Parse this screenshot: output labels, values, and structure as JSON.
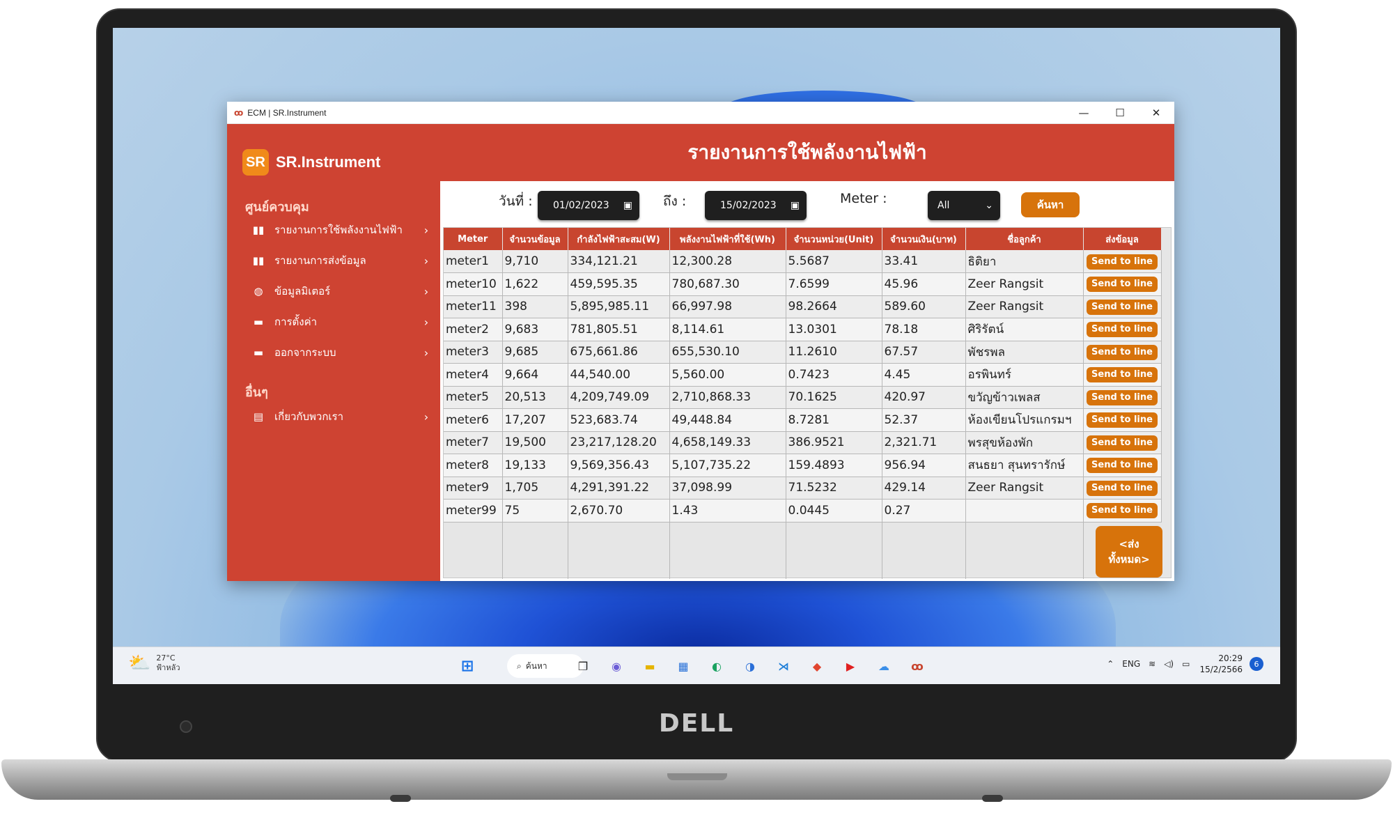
{
  "window": {
    "title": "ECM | SR.Instrument",
    "minimize": "—",
    "maximize": "☐",
    "close": "✕"
  },
  "brand": {
    "logo": "SR",
    "name": "SR.Instrument"
  },
  "sidebar": {
    "section_main": "ศูนย์ควบคุม",
    "section_other": "อื่นๆ",
    "items": [
      {
        "label": "รายงานการใช้พลังงานไฟฟ้า",
        "icon": "bar-chart-icon"
      },
      {
        "label": "รายงานการส่งข้อมูล",
        "icon": "bar-chart-icon"
      },
      {
        "label": "ข้อมูลมิเตอร์",
        "icon": "globe-icon"
      },
      {
        "label": "การตั้งค่า",
        "icon": "paint-roller-icon"
      },
      {
        "label": "ออกจากระบบ",
        "icon": "paint-roller-icon"
      },
      {
        "label": "เกี่ยวกับพวกเรา",
        "icon": "book-icon"
      }
    ]
  },
  "header": {
    "title": "รายงานการใช้พลังงานไฟฟ้า"
  },
  "filters": {
    "from_label": "วันที่ :",
    "from_value": "01/02/2023",
    "to_label": "ถึง :",
    "to_value": "15/02/2023",
    "meter_label": "Meter :",
    "meter_value": "All",
    "search_label": "ค้นหา"
  },
  "table": {
    "columns": [
      "Meter",
      "จำนวนข้อมูล",
      "กำลังไฟฟ้าสะสม(W)",
      "พลังงานไฟฟ้าที่ใช้(Wh)",
      "จำนวนหน่วย(Unit)",
      "จำนวนเงิน(บาท)",
      "ชื่อลูกค้า",
      "ส่งข้อมูล"
    ],
    "action_label": "Send to line",
    "send_all_label": "<ส่งทั้งหมด>",
    "rows": [
      [
        "meter1",
        "9,710",
        "334,121.21",
        "12,300.28",
        "5.5687",
        "33.41",
        "ธิติยา"
      ],
      [
        "meter10",
        "1,622",
        "459,595.35",
        "780,687.30",
        "7.6599",
        "45.96",
        "Zeer Rangsit"
      ],
      [
        "meter11",
        "398",
        "5,895,985.11",
        "66,997.98",
        "98.2664",
        "589.60",
        "Zeer Rangsit"
      ],
      [
        "meter2",
        "9,683",
        "781,805.51",
        "8,114.61",
        "13.0301",
        "78.18",
        "ศิริรัตน์"
      ],
      [
        "meter3",
        "9,685",
        "675,661.86",
        "655,530.10",
        "11.2610",
        "67.57",
        "พัชรพล"
      ],
      [
        "meter4",
        "9,664",
        "44,540.00",
        "5,560.00",
        "0.7423",
        "4.45",
        "อรพินทร์"
      ],
      [
        "meter5",
        "20,513",
        "4,209,749.09",
        "2,710,868.33",
        "70.1625",
        "420.97",
        "ขวัญข้าวเพลส"
      ],
      [
        "meter6",
        "17,207",
        "523,683.74",
        "49,448.84",
        "8.7281",
        "52.37",
        "ห้องเขียนโปรแกรมฯ"
      ],
      [
        "meter7",
        "19,500",
        "23,217,128.20",
        "4,658,149.33",
        "386.9521",
        "2,321.71",
        "พรสุขห้องพัก"
      ],
      [
        "meter8",
        "19,133",
        "9,569,356.43",
        "5,107,735.22",
        "159.4893",
        "956.94",
        "สนธยา สุนทรารักษ์"
      ],
      [
        "meter9",
        "1,705",
        "4,291,391.22",
        "37,098.99",
        "71.5232",
        "429.14",
        "Zeer Rangsit"
      ],
      [
        "meter99",
        "75",
        "2,670.70",
        "1.43",
        "0.0445",
        "0.27",
        ""
      ]
    ]
  },
  "taskbar": {
    "weather_temp": "27°C",
    "weather_desc": "ฟ้าหลัว",
    "search_label": "ค้นหา",
    "language": "ENG",
    "time": "20:29",
    "date": "15/2/2566",
    "notifications": "6"
  },
  "laptop": {
    "brand": "DELL"
  }
}
